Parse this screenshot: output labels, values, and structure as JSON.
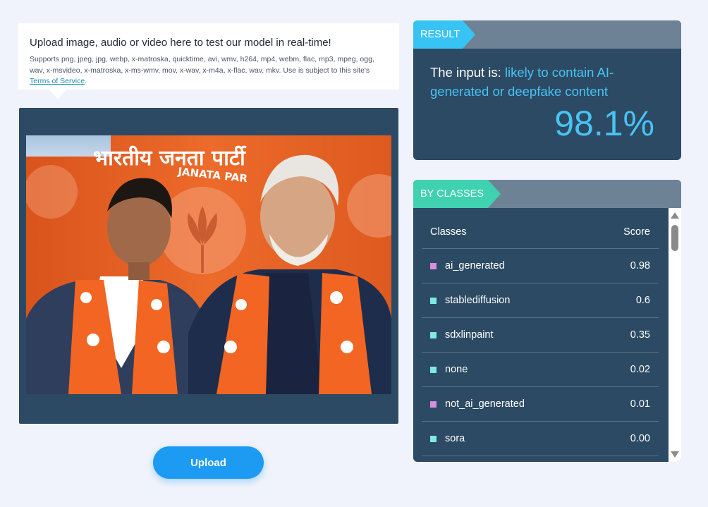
{
  "upload_info": {
    "title": "Upload image, audio or video here to test our model in real-time!",
    "description": "Supports png, jpeg, jpg, webp, x-matroska, quicktime, avi, wmv, h264, mp4, webm, flac, mp3, mpeg, ogg, wav, x-msvideo, x-matroska, x-ms-wmv, mov, x-wav, x-m4a, x-flac, wav, mkv. Use is subject to this site's ",
    "terms_link": "Terms of Service",
    "after_link": "."
  },
  "image": {
    "banner_text_1": "भारतीय जनता पार्टी",
    "banner_text_2": "JANATA PAR"
  },
  "upload_button": "Upload",
  "result": {
    "tag": "RESULT",
    "prefix": "The input is: ",
    "verdict": "likely to contain AI-generated or deepfake content",
    "score": "98.1%"
  },
  "by_classes": {
    "tag": "BY CLASSES",
    "header_class": "Classes",
    "header_score": "Score",
    "rows": [
      {
        "name": "ai_generated",
        "score": "0.98",
        "color": "#d98ce0"
      },
      {
        "name": "stablediffusion",
        "score": "0.6",
        "color": "#7eeae2"
      },
      {
        "name": "sdxlinpaint",
        "score": "0.35",
        "color": "#7eeae2"
      },
      {
        "name": "none",
        "score": "0.02",
        "color": "#7eeae2"
      },
      {
        "name": "not_ai_generated",
        "score": "0.01",
        "color": "#d98ce0"
      },
      {
        "name": "sora",
        "score": "0.00",
        "color": "#7eeae2"
      }
    ]
  },
  "colors": {
    "panel_bg": "#2c4a63",
    "result_accent": "#38c3f5",
    "classes_accent": "#3fd1b0",
    "button": "#1d9af2"
  }
}
